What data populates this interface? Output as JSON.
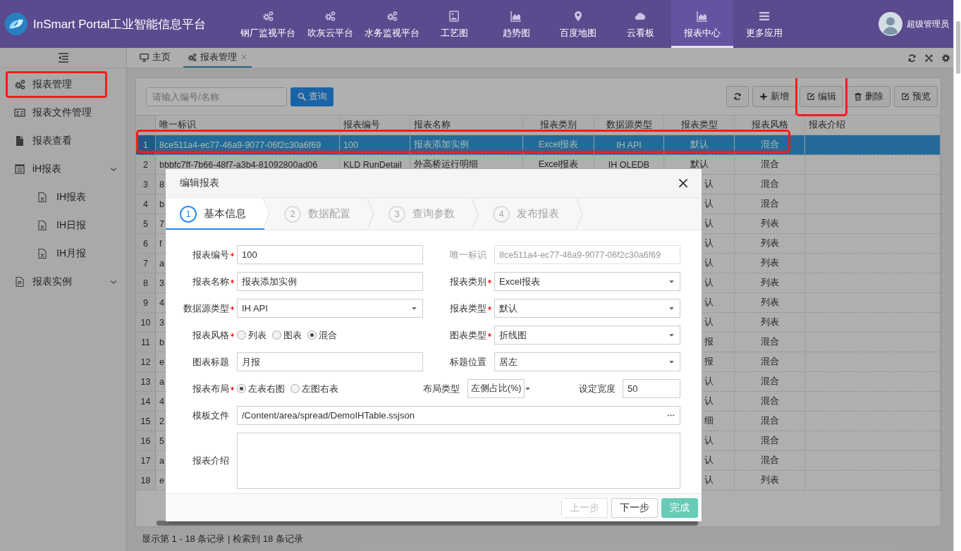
{
  "header": {
    "title": "InSmart Portal工业智能信息平台",
    "nav": [
      {
        "label": "钢厂监视平台",
        "kind": "gears",
        "selected": false
      },
      {
        "label": "吹灰云平台",
        "kind": "gears",
        "selected": false
      },
      {
        "label": "水务监视平台",
        "kind": "gears",
        "selected": false
      },
      {
        "label": "工艺图",
        "kind": "picture",
        "selected": false
      },
      {
        "label": "趋势图",
        "kind": "area",
        "selected": false
      },
      {
        "label": "百度地图",
        "kind": "pin",
        "selected": false
      },
      {
        "label": "云看板",
        "kind": "cloud",
        "selected": false
      },
      {
        "label": "报表中心",
        "kind": "area",
        "selected": true
      },
      {
        "label": "更多应用",
        "kind": "bars",
        "selected": false
      }
    ],
    "user": "超级管理员"
  },
  "sidebar": {
    "items": [
      {
        "label": "报表管理",
        "kind": "gears",
        "submenu": false,
        "annotated": true
      },
      {
        "label": "报表文件管理",
        "kind": "card",
        "submenu": false,
        "annotated": false
      },
      {
        "label": "报表查看",
        "kind": "file",
        "submenu": false,
        "annotated": false
      },
      {
        "label": "iH报表",
        "kind": "listdoc",
        "submenu": true,
        "annotated": false,
        "children": [
          {
            "label": "IH报表"
          },
          {
            "label": "IH日报"
          },
          {
            "label": "IH月报"
          }
        ]
      },
      {
        "label": "报表实例",
        "kind": "pfile",
        "submenu": true,
        "annotated": false
      }
    ]
  },
  "tabs": [
    {
      "label": "主页",
      "kind": "monitor",
      "selected": false,
      "closable": false
    },
    {
      "label": "报表管理",
      "kind": "gears",
      "selected": true,
      "closable": true
    }
  ],
  "toolbar": {
    "search": {
      "placeholder": "请输入编号/名称"
    },
    "search_button": "查询",
    "buttons": [
      {
        "kind": "refresh",
        "annotated": false
      },
      {
        "label": "新增",
        "kind": "add",
        "annotated": false
      },
      {
        "label": "编辑",
        "kind": "edit",
        "annotated": true
      },
      {
        "label": "删除",
        "kind": "delete",
        "annotated": false
      },
      {
        "label": "预览",
        "kind": "preview",
        "annotated": false
      }
    ]
  },
  "table": {
    "columns": [
      "唯一标识",
      "报表编号",
      "报表名称",
      "报表类别",
      "数据源类型",
      "报表类型",
      "报表风格",
      "报表介绍"
    ],
    "rows": [
      {
        "number": "1",
        "selected": true,
        "annotated": true,
        "id": "8ce511a4-ec77-46a9-9077-06f2c30a6f69",
        "code": "100",
        "name": "报表添加实例",
        "category": "Excel报表",
        "source": "IH API",
        "type": "默认",
        "style": "混合"
      },
      {
        "number": "2",
        "selected": false,
        "annotated": false,
        "id": "bbbfc7ff-7b66-48f7-a3b4-81092800ad06",
        "code": "KLD RunDetail",
        "name": "外高桥运行明细",
        "category": "Excel报表",
        "source": "IH OLEDB",
        "type": "默认",
        "style": "混合"
      },
      {
        "number": "3",
        "selected": false,
        "annotated": false,
        "id": "8",
        "type": "认",
        "style": "混合"
      },
      {
        "number": "4",
        "selected": false,
        "annotated": false,
        "id": "b",
        "type": "认",
        "style": "混合"
      },
      {
        "number": "5",
        "selected": false,
        "annotated": false,
        "id": "7",
        "type": "认",
        "style": "列表"
      },
      {
        "number": "6",
        "selected": false,
        "annotated": false,
        "id": "f",
        "type": "认",
        "style": "列表"
      },
      {
        "number": "7",
        "selected": false,
        "annotated": false,
        "id": "a",
        "type": "认",
        "style": "列表"
      },
      {
        "number": "8",
        "selected": false,
        "annotated": false,
        "id": "3",
        "type": "认",
        "style": "列表"
      },
      {
        "number": "9",
        "selected": false,
        "annotated": false,
        "id": "4",
        "type": "认",
        "style": "列表"
      },
      {
        "number": "10",
        "selected": false,
        "annotated": false,
        "id": "3",
        "type": "认",
        "style": "列表"
      },
      {
        "number": "11",
        "selected": false,
        "annotated": false,
        "id": "b",
        "type": "报",
        "style": "混合"
      },
      {
        "number": "12",
        "selected": false,
        "annotated": false,
        "id": "e",
        "type": "报",
        "style": "混合"
      },
      {
        "number": "13",
        "selected": false,
        "annotated": false,
        "id": "a",
        "type": "认",
        "style": "混合"
      },
      {
        "number": "14",
        "selected": false,
        "annotated": false,
        "id": "4",
        "type": "认",
        "style": "混合"
      },
      {
        "number": "15",
        "selected": false,
        "annotated": false,
        "id": "2",
        "type": "细",
        "style": "混合"
      },
      {
        "number": "16",
        "selected": false,
        "annotated": false,
        "id": "5",
        "type": "认",
        "style": "混合"
      },
      {
        "number": "17",
        "selected": false,
        "annotated": false,
        "id": "a",
        "type": "认",
        "style": "混合"
      },
      {
        "number": "18",
        "selected": false,
        "annotated": false,
        "id": "e",
        "type": "认",
        "style": "列表"
      }
    ]
  },
  "status_bar": "显示第 1 - 18 条记录 | 检索到 18 条记录",
  "dialog": {
    "title": "编辑报表",
    "steps": [
      {
        "number": "1",
        "label": "基本信息",
        "selected": true
      },
      {
        "number": "2",
        "label": "数据配置",
        "selected": false
      },
      {
        "number": "3",
        "label": "查询参数",
        "selected": false
      },
      {
        "number": "4",
        "label": "发布报表",
        "selected": false
      }
    ],
    "rows": [
      {
        "fields": [
          {
            "label": "报表编号",
            "required": true,
            "kind": "text",
            "value": "100",
            "disabled": false
          },
          {
            "label": "唯一标识",
            "required": false,
            "kind": "text",
            "value": "8ce511a4-ec77-46a9-9077-06f2c30a6f69",
            "disabled": true
          }
        ]
      },
      {
        "fields": [
          {
            "label": "报表名称",
            "required": true,
            "kind": "text",
            "value": "报表添加实例",
            "disabled": false
          },
          {
            "label": "报表类别",
            "required": true,
            "kind": "select",
            "value": "Excel报表",
            "disabled": false
          }
        ]
      },
      {
        "fields": [
          {
            "label": "数据源类型",
            "required": true,
            "kind": "select",
            "value": "IH API",
            "disabled": false
          },
          {
            "label": "报表类型",
            "required": true,
            "kind": "select",
            "value": "默认",
            "disabled": false
          }
        ]
      },
      {
        "fields": [
          {
            "label": "报表风格",
            "required": true,
            "kind": "radio",
            "disabled": false,
            "options": [
              {
                "label": "列表",
                "selected": false
              },
              {
                "label": "图表",
                "selected": false
              },
              {
                "label": "混合",
                "selected": true
              }
            ]
          },
          {
            "label": "图表类型",
            "required": true,
            "kind": "select",
            "value": "折线图",
            "disabled": false
          }
        ]
      },
      {
        "fields": [
          {
            "label": "图表标题",
            "required": false,
            "kind": "text",
            "value": "月报",
            "disabled": false
          },
          {
            "label": "标题位置",
            "required": false,
            "kind": "select",
            "value": "居左",
            "disabled": false
          }
        ]
      },
      {
        "fields": [
          {
            "label": "报表布局",
            "required": true,
            "kind": "radio",
            "disabled": false,
            "options": [
              {
                "label": "左表右图",
                "selected": true
              },
              {
                "label": "左图右表",
                "selected": false
              }
            ]
          },
          {
            "label": "布局类型",
            "required": false,
            "kind": "select",
            "value": "左侧占比(%)",
            "disabled": false
          },
          {
            "label": "设定宽度",
            "required": false,
            "kind": "text",
            "value": "50",
            "disabled": false
          }
        ]
      },
      {
        "fields": [
          {
            "label": "模板文件",
            "required": false,
            "kind": "file",
            "value": "/Content/area/spread/DemoIHTable.ssjson",
            "disabled": false
          }
        ]
      },
      {
        "fields": [
          {
            "label": "报表介绍",
            "required": false,
            "kind": "textarea",
            "disabled": false
          }
        ]
      }
    ],
    "buttons": [
      {
        "label": "上一步",
        "kind": "default",
        "disabled": true
      },
      {
        "label": "下一步",
        "kind": "default",
        "disabled": false
      },
      {
        "label": "完成",
        "kind": "primary",
        "disabled": true
      }
    ]
  }
}
